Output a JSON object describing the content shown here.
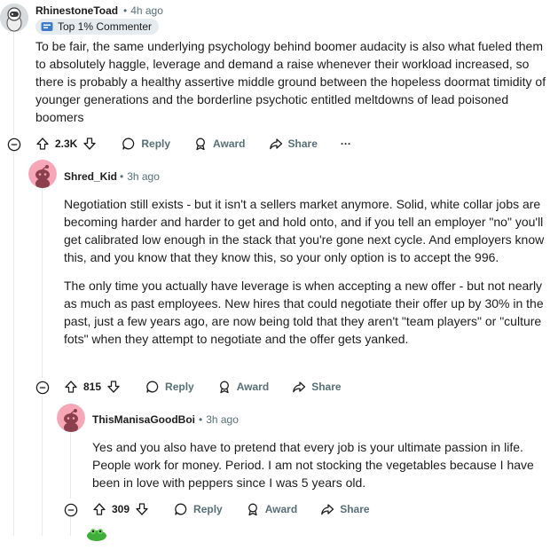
{
  "comments": [
    {
      "author": "RhinestoneToad",
      "time": "4h ago",
      "flair": "Top 1% Commenter",
      "paragraphs": [
        "To be fair, the same underlying psychology behind boomer audacity is also what fueled them to absolutely haggle, leverage and demand a raise whenever their workload increased, so there is probably a healthy assertive middle ground between the hopeless doormat timidity of younger generations and the borderline psychotic entitled meltdowns of lead poisoned boomers"
      ],
      "votes": "2.3K",
      "reply_label": "Reply",
      "award_label": "Award",
      "share_label": "Share",
      "more_label": "···"
    },
    {
      "author": "Shred_Kid",
      "time": "3h ago",
      "paragraphs": [
        "Negotiation still exists - but it isn't a sellers market anymore. Solid, white collar jobs are becoming harder and harder to get and hold onto, and if you tell an employer \"no\" you'll get calibrated low enough in the stack that you're gone next cycle. And employers know this, and you know that they know this, so your only option is to accept the 996.",
        "The only time you actually have leverage is when accepting a new offer - but not nearly as much as past employees. New hires that could negotiate their offer up by 30% in the past, just a few years ago, are now being told that they aren't \"team players\" or \"culture fots\" when they attempt to negotiate and the offer gets yanked."
      ],
      "votes": "815",
      "reply_label": "Reply",
      "award_label": "Award",
      "share_label": "Share"
    },
    {
      "author": "ThisManisaGoodBoi",
      "time": "3h ago",
      "paragraphs": [
        "Yes and you also have to pretend that every job is your ultimate passion in life. People work for money. Period. I am not stocking the vegetables because I have been in love with peppers since I was 5 years old."
      ],
      "votes": "309",
      "reply_label": "Reply",
      "award_label": "Award",
      "share_label": "Share"
    }
  ],
  "colors": {
    "text": "#1c1c1c",
    "meta": "#576f76",
    "thread_line": "#e5ebee",
    "avatar_pink": "#f7a6b7",
    "snoo_dark": "#8c3f4c",
    "flair_bg": "#e5ebee"
  },
  "icons": [
    "upvote-icon",
    "downvote-icon",
    "reply-icon",
    "award-icon",
    "share-icon",
    "collapse-icon",
    "flair-badge-icon"
  ]
}
